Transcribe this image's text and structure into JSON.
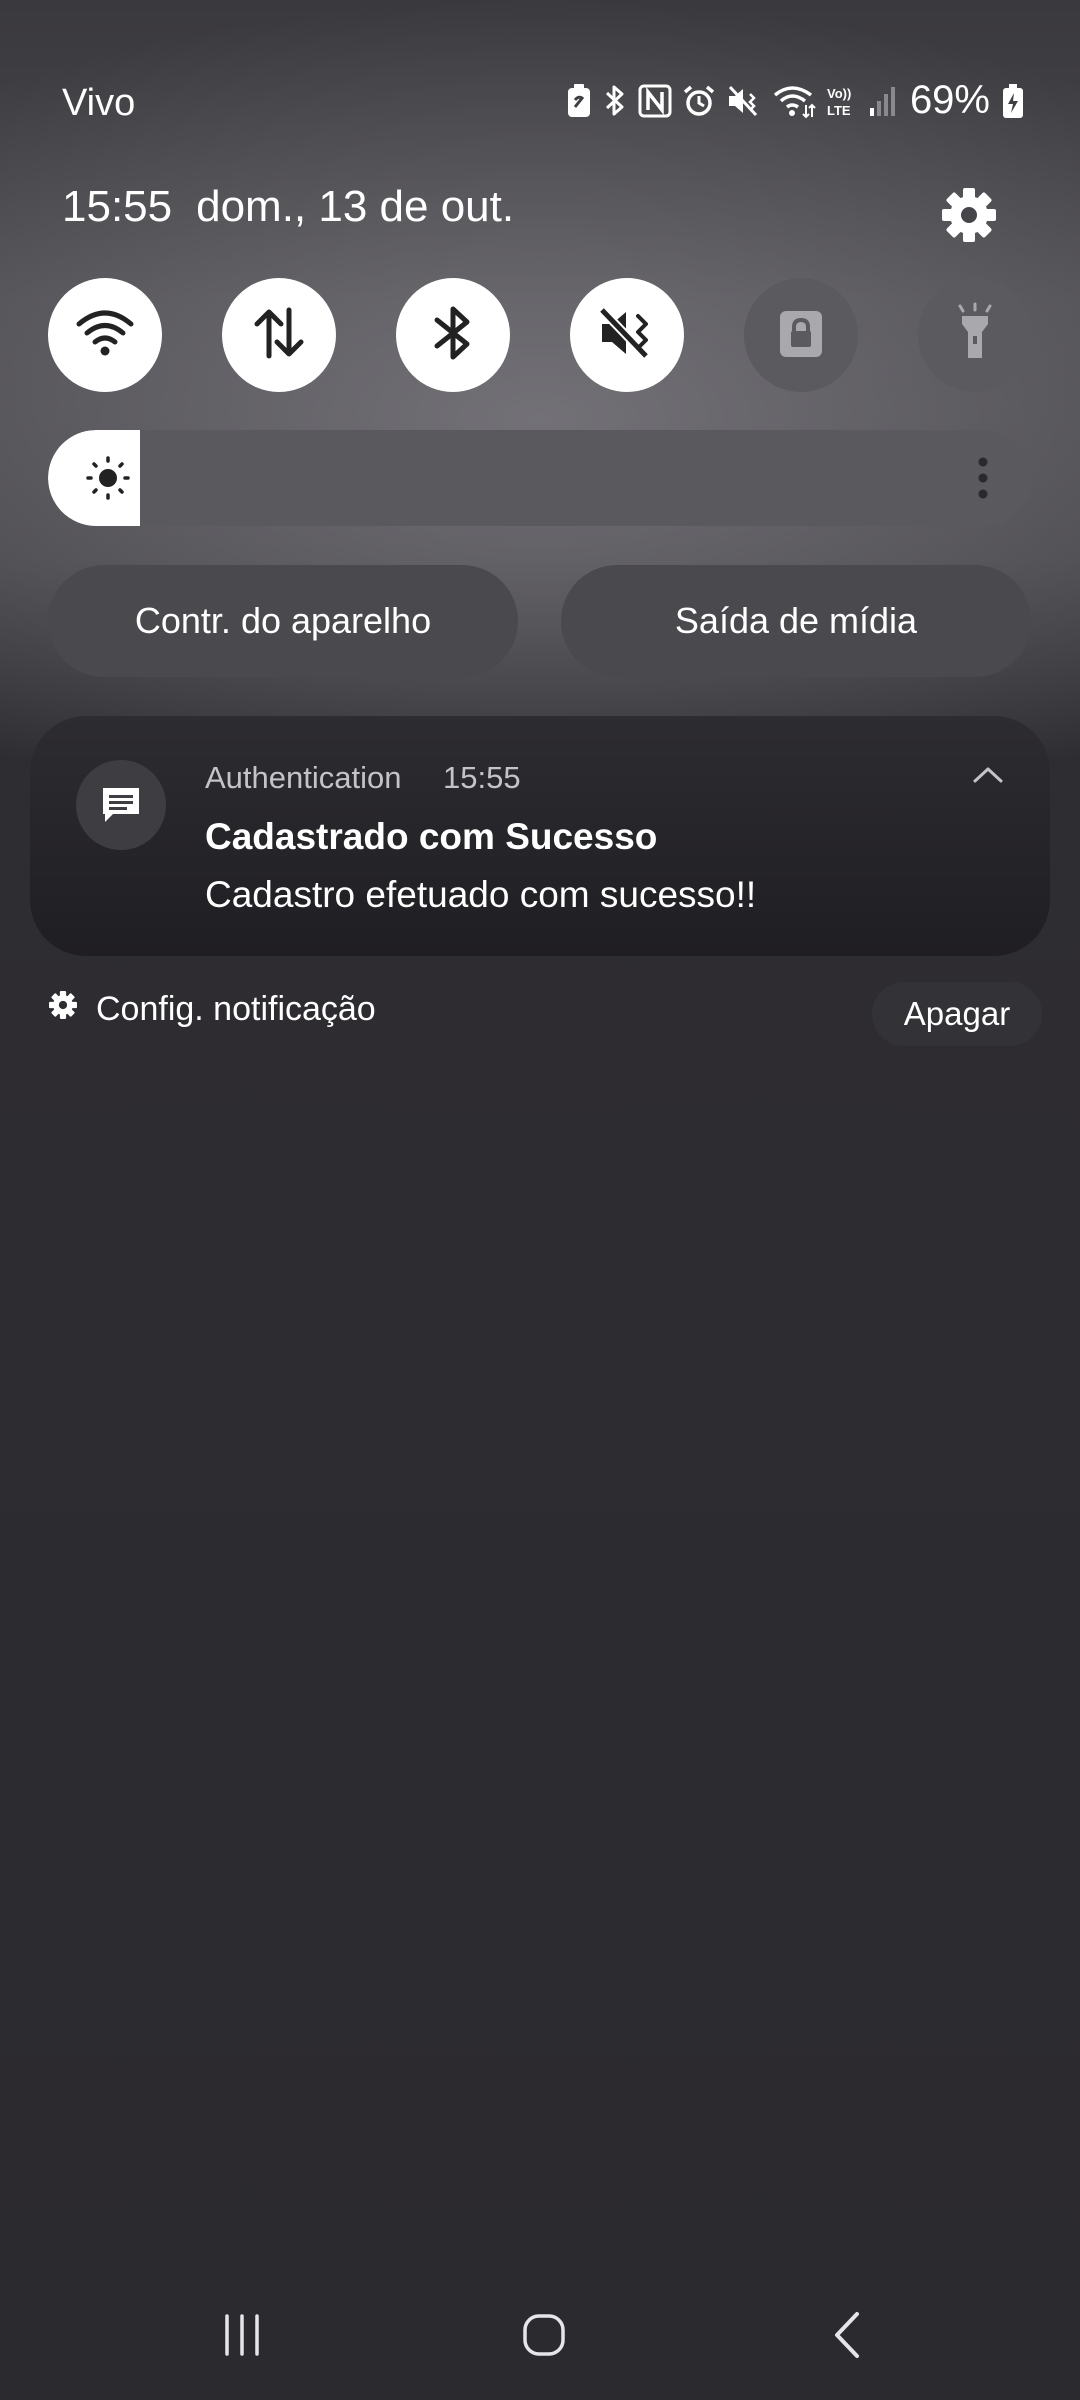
{
  "status_bar": {
    "carrier": "Vivo",
    "battery_percent": "69%",
    "icons": [
      "battery-saver-icon",
      "bluetooth-icon",
      "nfc-icon",
      "alarm-icon",
      "mute-icon",
      "wifi-icon",
      "volte-icon",
      "signal-icon",
      "battery-charging-icon"
    ]
  },
  "header": {
    "time": "15:55",
    "date": "dom., 13 de out."
  },
  "quick_toggles": [
    {
      "name": "wifi",
      "icon": "wifi-icon",
      "state": "on"
    },
    {
      "name": "mobile-data",
      "icon": "mobile-data-icon",
      "state": "on"
    },
    {
      "name": "bluetooth",
      "icon": "bluetooth-icon",
      "state": "on"
    },
    {
      "name": "sound",
      "icon": "mute-icon",
      "state": "on"
    },
    {
      "name": "rotation-lock",
      "icon": "lock-icon",
      "state": "off"
    },
    {
      "name": "flashlight",
      "icon": "flashlight-icon",
      "state": "off"
    }
  ],
  "brightness": {
    "level": 0.06
  },
  "pills": {
    "device_control": "Contr. do aparelho",
    "media_output": "Saída de mídia"
  },
  "notification": {
    "app": "Authentication",
    "time": "15:55",
    "title": "Cadastrado com Sucesso",
    "body": "Cadastro efetuado com sucesso!!"
  },
  "footer": {
    "settings_label": "Config. notificação",
    "clear_label": "Apagar"
  },
  "nav": [
    "recents-icon",
    "home-icon",
    "back-icon"
  ]
}
